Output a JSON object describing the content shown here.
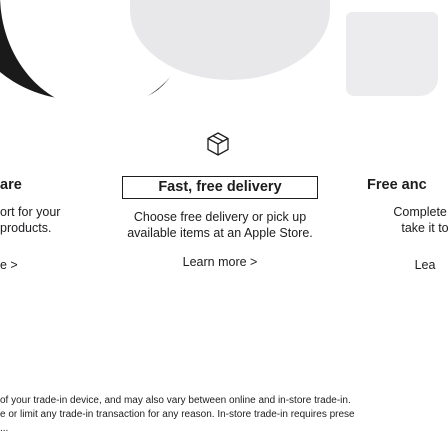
{
  "left": {
    "title": "are",
    "body_line1": "ort for your",
    "body_line2": "products.",
    "link": "e >"
  },
  "middle": {
    "title": "Fast, free delivery",
    "body": "Choose free delivery or pick up available items at an Apple Store.",
    "link": "Learn more >",
    "icon": "delivery-box-icon"
  },
  "right": {
    "title": "Free anc",
    "body_line1": "Complete y",
    "body_line2": "take it to",
    "link": "Lea"
  },
  "footnote": {
    "line1": "of your trade-in device, and may also vary between online and in-store trade-in.",
    "line2": "e or limit any trade-in transaction for any reason. In-store trade-in requires prese",
    "line3": "..."
  },
  "colors": {
    "text": "#1d1d1f",
    "hero_dark": "#1a1a1a",
    "hero_grey": "#e8e8ea"
  }
}
